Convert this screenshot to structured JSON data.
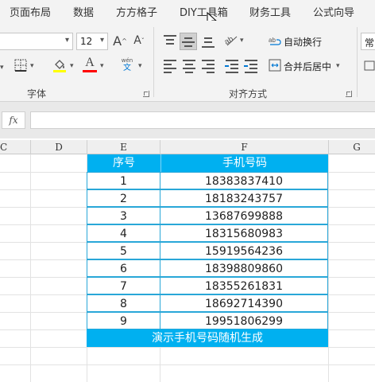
{
  "ribbon_tabs": [
    "页面布局",
    "数据",
    "方方格子",
    "DIY工具箱",
    "财务工具",
    "公式向导"
  ],
  "font": {
    "size_value": "12",
    "grow_label": "A",
    "shrink_label": "A",
    "font_color_letter": "A",
    "phonetic_top": "wén",
    "phonetic_bottom": "文",
    "group_label": "字体"
  },
  "alignment": {
    "wrap_text_label": "自动换行",
    "merge_center_label": "合并后居中",
    "group_label": "对齐方式"
  },
  "number_format_partial": "常",
  "formula_bar": {
    "fx_label": "fx",
    "value": ""
  },
  "column_headers": [
    "C",
    "D",
    "E",
    "F",
    "G"
  ],
  "table": {
    "headers": [
      "序号",
      "手机号码"
    ],
    "rows": [
      [
        "1",
        "18383837410"
      ],
      [
        "2",
        "18183243757"
      ],
      [
        "3",
        "13687699888"
      ],
      [
        "4",
        "18315680983"
      ],
      [
        "5",
        "15919564236"
      ],
      [
        "6",
        "18398809860"
      ],
      [
        "7",
        "18355261831"
      ],
      [
        "8",
        "18692714390"
      ],
      [
        "9",
        "19951806299"
      ]
    ],
    "footer": "演示手机号码随机生成"
  },
  "colors": {
    "table_header_fill": "#00b0f0",
    "table_border": "#29a7d8",
    "highlight_yellow": "#ffff00",
    "font_red": "#ff0000"
  }
}
